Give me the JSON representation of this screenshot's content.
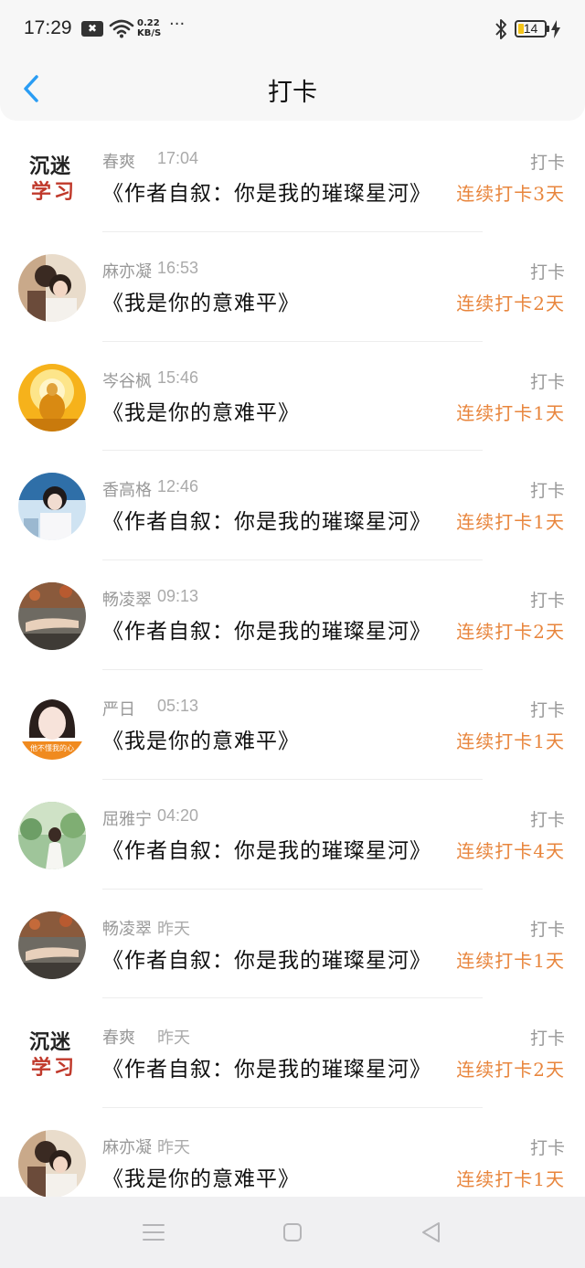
{
  "status_bar": {
    "time": "17:29",
    "notification_glyph": "✖",
    "net_speed_value": "0.22",
    "net_speed_unit": "KB/S",
    "more": "···",
    "battery_level": "14"
  },
  "header": {
    "title": "打卡",
    "back_icon": "chevron-left-icon"
  },
  "avatars": {
    "logo_line1": "沉迷",
    "logo_line2": "学习",
    "caption_girl": "他不懂我的心"
  },
  "entries": [
    {
      "name": "春爽",
      "time": "17:04",
      "book": "《作者自叙：你是我的璀璨星河》",
      "type": "打卡",
      "streak": "连续打卡3天"
    },
    {
      "name": "麻亦凝",
      "time": "16:53",
      "book": "《我是你的意难平》",
      "type": "打卡",
      "streak": "连续打卡2天"
    },
    {
      "name": "岑谷枫",
      "time": "15:46",
      "book": "《我是你的意难平》",
      "type": "打卡",
      "streak": "连续打卡1天"
    },
    {
      "name": "香高格",
      "time": "12:46",
      "book": "《作者自叙：你是我的璀璨星河》",
      "type": "打卡",
      "streak": "连续打卡1天"
    },
    {
      "name": "畅凌翠",
      "time": "09:13",
      "book": "《作者自叙：你是我的璀璨星河》",
      "type": "打卡",
      "streak": "连续打卡2天"
    },
    {
      "name": "严日",
      "time": "05:13",
      "book": "《我是你的意难平》",
      "type": "打卡",
      "streak": "连续打卡1天"
    },
    {
      "name": "屈雅宁",
      "time": "04:20",
      "book": "《作者自叙：你是我的璀璨星河》",
      "type": "打卡",
      "streak": "连续打卡4天"
    },
    {
      "name": "畅凌翠",
      "time": "昨天",
      "book": "《作者自叙：你是我的璀璨星河》",
      "type": "打卡",
      "streak": "连续打卡1天"
    },
    {
      "name": "春爽",
      "time": "昨天",
      "book": "《作者自叙：你是我的璀璨星河》",
      "type": "打卡",
      "streak": "连续打卡2天"
    },
    {
      "name": "麻亦凝",
      "time": "昨天",
      "book": "《我是你的意难平》",
      "type": "打卡",
      "streak": "连续打卡1天"
    }
  ],
  "nav_bar": {
    "menu_icon": "menu-icon",
    "home_icon": "home-square-icon",
    "back_icon": "back-triangle-icon"
  },
  "colors": {
    "accent": "#e8853c",
    "back_arrow": "#2a9df4"
  }
}
